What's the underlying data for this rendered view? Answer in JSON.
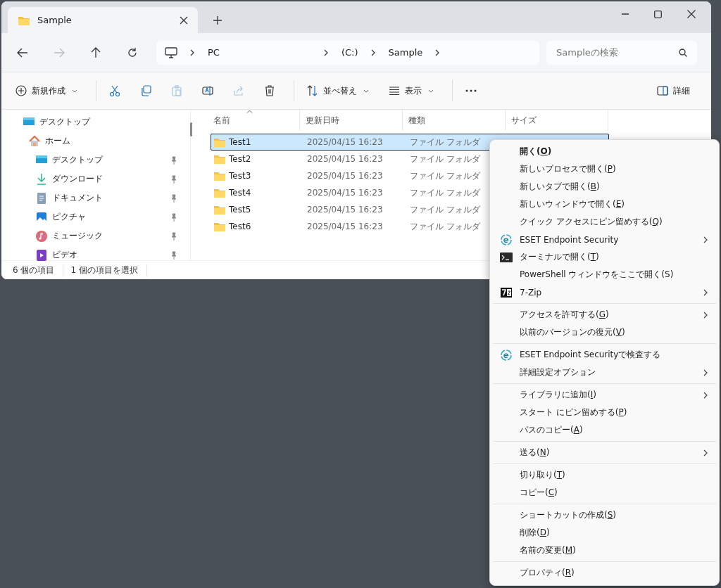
{
  "window": {
    "tab": {
      "title": "Sample",
      "selected": true
    }
  },
  "nav_buttons": [
    {
      "kind": "back",
      "disabled": false
    },
    {
      "kind": "forward",
      "disabled": true
    },
    {
      "kind": "up",
      "disabled": false
    },
    {
      "kind": "refresh",
      "disabled": false
    }
  ],
  "address_bar": {
    "segments": [
      "PC",
      "(C:)",
      "Sample"
    ]
  },
  "search": {
    "placeholder": "Sampleの検索"
  },
  "toolbar": [
    {
      "kind": "new",
      "label": "新規作成",
      "disabled": false
    },
    {
      "kind": "cut",
      "disabled": false
    },
    {
      "kind": "copy",
      "disabled": false
    },
    {
      "kind": "paste",
      "disabled": true
    },
    {
      "kind": "rename",
      "disabled": false
    },
    {
      "kind": "share",
      "disabled": true
    },
    {
      "kind": "delete",
      "disabled": false
    },
    {
      "kind": "sort",
      "label": "並べ替え",
      "disabled": false
    },
    {
      "kind": "view",
      "label": "表示",
      "disabled": false
    },
    {
      "kind": "more",
      "disabled": false
    },
    {
      "kind": "details",
      "label": "詳細",
      "disabled": false
    }
  ],
  "sidebar": {
    "items": [
      {
        "label": "デスクトップ",
        "kind": "desktop",
        "pinned": false
      },
      {
        "label": "ホーム",
        "kind": "home",
        "pinned": false,
        "children": [
          {
            "label": "デスクトップ",
            "kind": "desktop",
            "pinned": true
          },
          {
            "label": "ダウンロード",
            "kind": "download",
            "pinned": true
          },
          {
            "label": "ドキュメント",
            "kind": "document",
            "pinned": true
          },
          {
            "label": "ピクチャ",
            "kind": "picture",
            "pinned": true
          },
          {
            "label": "ミュージック",
            "kind": "music",
            "pinned": true
          },
          {
            "label": "ビデオ",
            "kind": "video",
            "pinned": true
          }
        ]
      }
    ]
  },
  "table": {
    "columns": [
      "名前",
      "更新日時",
      "種類",
      "サイズ"
    ],
    "rows": [
      {
        "name": "Test1",
        "modified": "2025/04/15 16:23",
        "type": "ファイル フォルダ",
        "selected": true
      },
      {
        "name": "Test2",
        "modified": "2025/04/15 16:23",
        "type": "ファイル フォルダ",
        "selected": false
      },
      {
        "name": "Test3",
        "modified": "2025/04/15 16:23",
        "type": "ファイル フォルダ",
        "selected": false
      },
      {
        "name": "Test4",
        "modified": "2025/04/15 16:23",
        "type": "ファイル フォルダ",
        "selected": false
      },
      {
        "name": "Test5",
        "modified": "2025/04/15 16:23",
        "type": "ファイル フォルダ",
        "selected": false
      },
      {
        "name": "Test6",
        "modified": "2025/04/15 16:23",
        "type": "ファイル フォルダ",
        "selected": false
      }
    ]
  },
  "status_bar": [
    "6 個の項目",
    "1 個の項目を選択"
  ],
  "context_menu": {
    "groups": [
      [
        {
          "text": "開く(",
          "key": "O",
          "text_end": ")",
          "default": true,
          "kind": "plain",
          "submenu": false
        },
        {
          "text": "新しいプロセスで開く(",
          "key": "P",
          "text_end": ")",
          "default": false,
          "kind": "plain",
          "submenu": false
        },
        {
          "text": "新しいタブで開く(",
          "key": "B",
          "text_end": ")",
          "default": false,
          "kind": "plain",
          "submenu": false
        },
        {
          "text": "新しいウィンドウで開く(",
          "key": "E",
          "text_end": ")",
          "default": false,
          "kind": "plain",
          "submenu": false
        },
        {
          "text": "クイック アクセスにピン留めする(",
          "key": "Q",
          "text_end": ")",
          "default": false,
          "kind": "plain",
          "submenu": false
        },
        {
          "text": "ESET Endpoint Security",
          "default": false,
          "kind": "eset",
          "submenu": true
        },
        {
          "text": "ターミナルで開く(",
          "key": "T",
          "text_end": ")",
          "default": false,
          "kind": "terminal",
          "submenu": false
        },
        {
          "text": "PowerShell ウィンドウをここで開く(S)",
          "default": false,
          "kind": "plain",
          "submenu": false
        },
        {
          "text": "7-Zip",
          "default": false,
          "kind": "archive",
          "submenu": true
        }
      ],
      [
        {
          "text": "アクセスを許可する(",
          "key": "G",
          "text_end": ")",
          "default": false,
          "kind": "plain",
          "submenu": true
        },
        {
          "text": "以前のバージョンの復元(",
          "key": "V",
          "text_end": ")",
          "default": false,
          "kind": "plain",
          "submenu": false
        }
      ],
      [
        {
          "text": "ESET Endpoint Securityで検査する",
          "default": false,
          "kind": "eset",
          "submenu": false
        },
        {
          "text": "詳細設定オプション",
          "default": false,
          "kind": "plain",
          "submenu": true
        }
      ],
      [
        {
          "text": "ライブラリに追加(",
          "key": "I",
          "text_end": ")",
          "default": false,
          "kind": "plain",
          "submenu": true
        },
        {
          "text": "スタート にピン留めする(",
          "key": "P",
          "text_end": ")",
          "default": false,
          "kind": "plain",
          "submenu": false
        },
        {
          "text": "パスのコピー(",
          "key": "A",
          "text_end": ")",
          "default": false,
          "kind": "plain",
          "submenu": false
        }
      ],
      [
        {
          "text": "送る(",
          "key": "N",
          "text_end": ")",
          "default": false,
          "kind": "plain",
          "submenu": true
        }
      ],
      [
        {
          "text": "切り取り(",
          "key": "T",
          "text_end": ")",
          "default": false,
          "kind": "plain",
          "submenu": false
        },
        {
          "text": "コピー(",
          "key": "C",
          "text_end": ")",
          "default": false,
          "kind": "plain",
          "submenu": false
        }
      ],
      [
        {
          "text": "ショートカットの作成(",
          "key": "S",
          "text_end": ")",
          "default": false,
          "kind": "plain",
          "submenu": false
        },
        {
          "text": "削除(",
          "key": "D",
          "text_end": ")",
          "default": false,
          "kind": "plain",
          "submenu": false
        },
        {
          "text": "名前の変更(",
          "key": "M",
          "text_end": ")",
          "default": false,
          "kind": "plain",
          "submenu": false
        }
      ],
      [
        {
          "text": "プロパティ(",
          "key": "R",
          "text_end": ")",
          "default": false,
          "kind": "plain",
          "submenu": false
        }
      ]
    ]
  }
}
